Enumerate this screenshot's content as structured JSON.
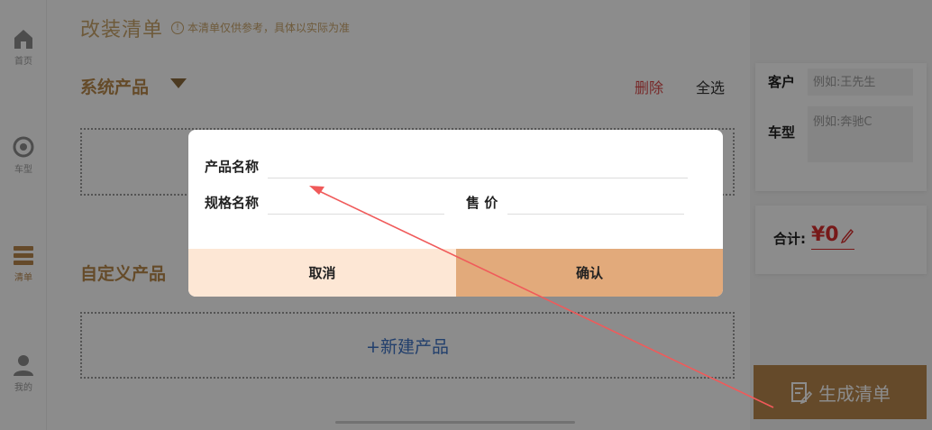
{
  "sidebar": {
    "items": [
      {
        "label": "首页",
        "icon": "home-icon"
      },
      {
        "label": "车型",
        "icon": "car-model-icon"
      },
      {
        "label": "清单",
        "icon": "list-icon"
      },
      {
        "label": "我的",
        "icon": "user-icon"
      }
    ]
  },
  "main": {
    "title": "改装清单",
    "note": "本清单仅供参考，具体以实际为准",
    "note_icon_glyph": "!",
    "system_section": {
      "title": "系统产品",
      "delete_label": "删除",
      "select_all_label": "全选"
    },
    "custom_section": {
      "title": "自定义产品",
      "new_product_label": "+新建产品"
    }
  },
  "right_panel": {
    "customer_label": "客户",
    "customer_placeholder": "例如:王先生",
    "model_label": "车型",
    "model_placeholder": "例如:奔驰C",
    "total_label": "合计:",
    "total_value": "¥0",
    "generate_button_label": "生成清单"
  },
  "dialog": {
    "product_name_label": "产品名称",
    "product_name_value": "",
    "spec_name_label": "规格名称",
    "spec_name_value": "",
    "price_label": "售 价",
    "price_value": "",
    "cancel_label": "取消",
    "confirm_label": "确认"
  },
  "colors": {
    "accent_gold": "#b9874e",
    "dialog_cancel_bg": "#fde7d5",
    "dialog_confirm_bg": "#e2aa7b",
    "danger_red": "#d94a4a",
    "link_blue": "#3e73c5",
    "annotation_arrow": "#f05a5a"
  }
}
